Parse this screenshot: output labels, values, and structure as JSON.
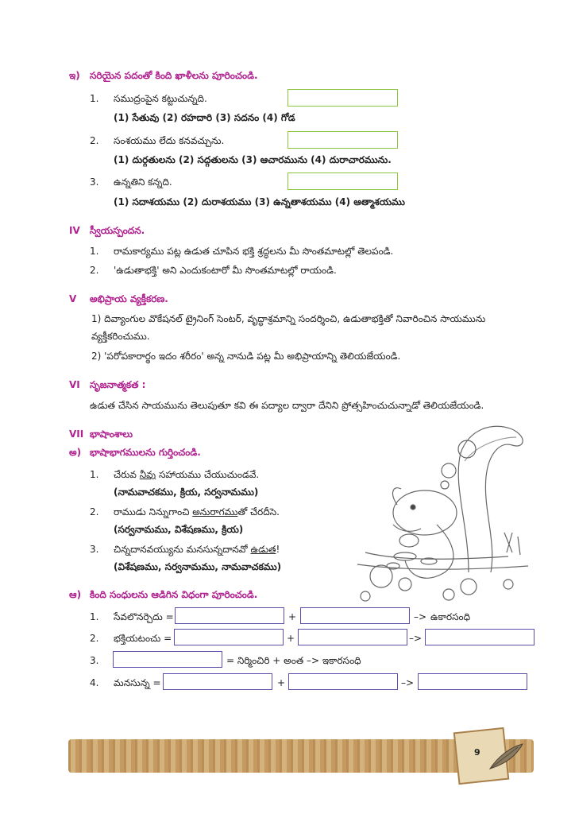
{
  "section_e": {
    "marker": "ఇ)",
    "title": "సరియైన పదంతో కింది ఖాళీలను పూరించండి.",
    "items": [
      {
        "n": "1.",
        "q": "సముద్రంపైన కట్టుచున్నది.",
        "opts": "(1) సేతువు (2) రహదారి (3) సదనం (4) గోడ"
      },
      {
        "n": "2.",
        "q": "సంశయము లేదు కనవచ్చును.",
        "opts": "(1) దుర్గతులను (2) సద్గతులను (3) ఆచారమును (4) దురాచారమును."
      },
      {
        "n": "3.",
        "q": "ఉన్నతిని కన్నది.",
        "opts": "(1) సదాశయము (2) దురాశయము (3) ఉన్నతాశయము (4) ఆత్మాశయము"
      }
    ]
  },
  "section_iv": {
    "marker": "IV",
    "title": "స్వీయస్పందన.",
    "items": [
      {
        "n": "1.",
        "t": "రామకార్యము పట్ల ఉడుత చూపిన భక్తి శ్రద్ధలను మీ సొంతమాటల్లో తెలపండి."
      },
      {
        "n": "2.",
        "t": "'ఉడుతాభక్తి' అని ఎందుకంటారో మీ సొంతమాటల్లో రాయండి."
      }
    ]
  },
  "section_v": {
    "marker": "V",
    "title": "అభిప్రాయ వ్యక్తీకరణ.",
    "item1_line1": "1)  దివ్యాంగుల వొకేషనల్ ట్రైనింగ్ సెంటర్, వృద్ధాశ్రమాన్ని సందర్శించి, ఉడుతాభక్తితో నివారించిన సాయమును",
    "item1_line2": "వ్యక్తీకరించుము.",
    "item2": "2)  'పరోపకారార్థం ఇదం శరీరం' అన్న నానుడి పట్ల మీ అభిప్రాయాన్ని తెలియజేయండి."
  },
  "section_vi": {
    "marker": "VI",
    "title": "సృజనాత్మకత :",
    "text": "ఉడుత చేసిన సాయమును తెలుపుతూ కవి ఈ పద్యాల ద్వారా దేనిని ప్రోత్సహించుచున్నాడో తెలియజేయండి."
  },
  "section_vii": {
    "marker": "VII",
    "title": "భాషాంశాలు",
    "sub_a": {
      "marker": "అ)",
      "title": "భాషాభాగములను గుర్తించండి.",
      "items": [
        {
          "n": "1.",
          "pre": "చేరువ ",
          "u": "నీవు",
          "post": " సహాయము చేయుచుండవే.",
          "opts": "(నామవాచకము, క్రియ, సర్వనామము)"
        },
        {
          "n": "2.",
          "pre": "రాముడు నిన్నుగాంచి ",
          "u": "అనురాగము",
          "post": "తో చేరదీసె.",
          "opts": "(సర్వనామము, విశేషణము, క్రియ)"
        },
        {
          "n": "3.",
          "pre": "చిన్నదానవయ్యును మనసున్నదానవో ",
          "u": "ఉడుత",
          "post": "!",
          "opts": "(విశేషణము, సర్వనామము, నామవాచకము)"
        }
      ]
    },
    "sub_aa": {
      "marker": "ఆ)",
      "title": "కింది సంధులను ఆడిగిన విధంగా పూరించండి.",
      "items": [
        {
          "n": "1.",
          "word": "సేవలొనర్చెదు =",
          "plus": "+",
          "arrow": "–>",
          "result": "ఉకారసంధి"
        },
        {
          "n": "2.",
          "word": "భక్తియటంచు =",
          "plus": "+",
          "arrow": "–>",
          "result": ""
        },
        {
          "n": "3.",
          "word": "",
          "eq": "= నిర్మించిరి + అంత –> ఇకారసంధి"
        },
        {
          "n": "4.",
          "word": "మనసున్న =",
          "plus": "+",
          "arrow": "–>",
          "result": ""
        }
      ]
    }
  },
  "footer": {
    "page_number": "9"
  },
  "colors": {
    "heading": "#b0228f",
    "green_box": "#8cc63f",
    "blue_box": "#5a4fa8",
    "banner": "#c9a36c"
  }
}
